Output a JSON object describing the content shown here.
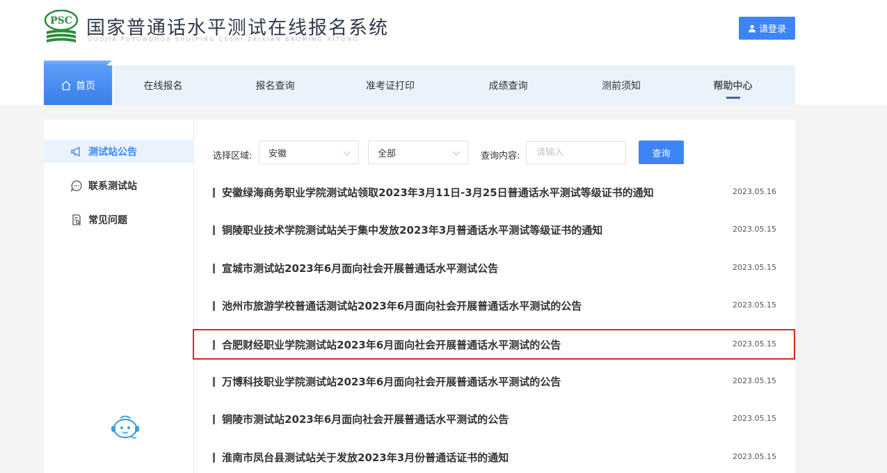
{
  "header": {
    "logo_text": "PSC",
    "title": "国家普通话水平测试在线报名系统",
    "subtitle": "GUOJIA PUTONGHUA SHUIPING CESHI ZAIXIAN BAOMING XITONG",
    "login_label": "请登录"
  },
  "nav": {
    "items": [
      {
        "label": "首页"
      },
      {
        "label": "在线报名"
      },
      {
        "label": "报名查询"
      },
      {
        "label": "准考证打印"
      },
      {
        "label": "成绩查询"
      },
      {
        "label": "测前须知"
      },
      {
        "label": "帮助中心"
      }
    ]
  },
  "sidebar": {
    "items": [
      {
        "label": "测试站公告",
        "icon": "megaphone-icon"
      },
      {
        "label": "联系测试站",
        "icon": "chat-icon"
      },
      {
        "label": "常见问题",
        "icon": "document-search-icon"
      }
    ]
  },
  "filters": {
    "region_label": "选择区域:",
    "region_value": "安徽",
    "sub_region_value": "全部",
    "query_label": "查询内容:",
    "query_placeholder": "请输入",
    "query_button": "查询"
  },
  "notices": [
    {
      "title": "安徽绿海商务职业学院测试站领取2023年3月11日-3月25日普通话水平测试等级证书的通知",
      "date": "2023.05.16"
    },
    {
      "title": "铜陵职业技术学院测试站关于集中发放2023年3月普通话水平测试等级证书的通知",
      "date": "2023.05.15"
    },
    {
      "title": "宣城市测试站2023年6月面向社会开展普通话水平测试公告",
      "date": "2023.05.15"
    },
    {
      "title": "池州市旅游学校普通话测试站2023年6月面向社会开展普通话水平测试的公告",
      "date": "2023.05.15"
    },
    {
      "title": "合肥财经职业学院测试站2023年6月面向社会开展普通话水平测试的公告",
      "date": "2023.05.15"
    },
    {
      "title": "万博科技职业学院测试站2023年6月面向社会开展普通话水平测试的公告",
      "date": "2023.05.15"
    },
    {
      "title": "铜陵市测试站2023年6月面向社会开展普通话水平测试的公告",
      "date": "2023.05.15"
    },
    {
      "title": "淮南市凤台县测试站关于发放2023年3月份普通话证书的通知",
      "date": "2023.05.15"
    }
  ],
  "colors": {
    "accent": "#3d85f7",
    "highlight_border": "#d9251d",
    "logo_green": "#2e8b3a"
  }
}
